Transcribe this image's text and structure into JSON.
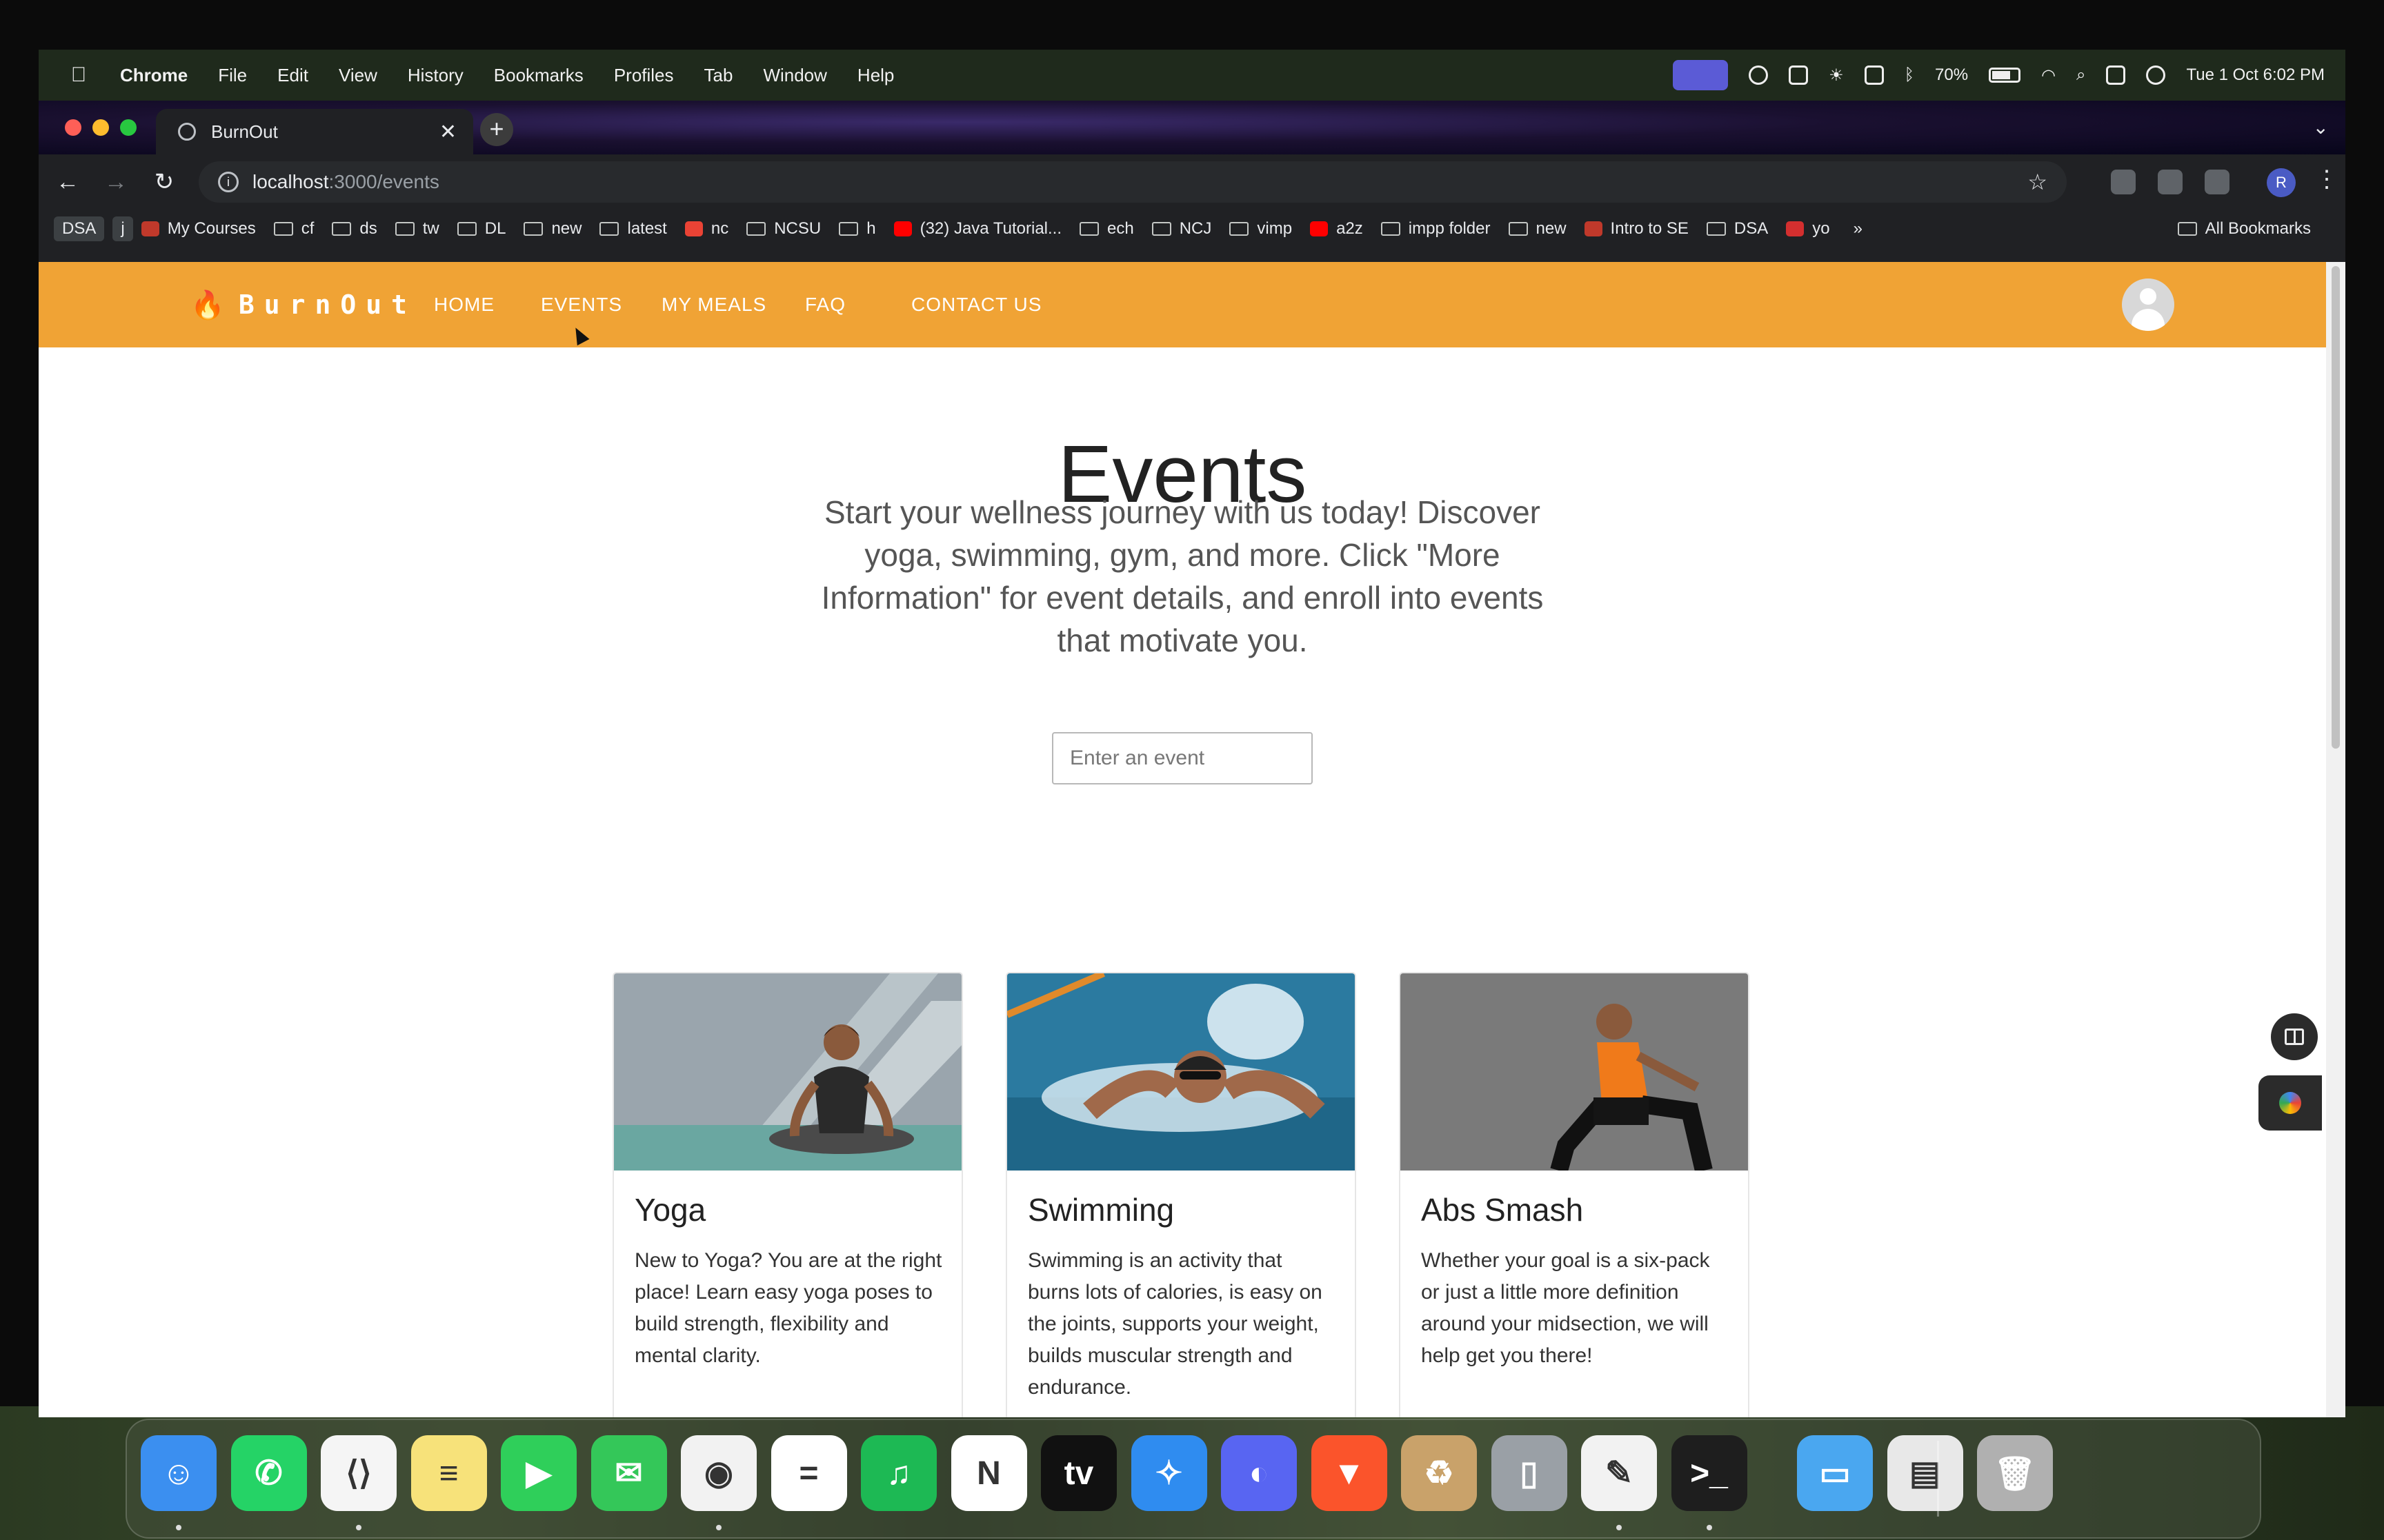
{
  "menubar": {
    "app_name": "Chrome",
    "menus": [
      "File",
      "Edit",
      "View",
      "History",
      "Bookmarks",
      "Profiles",
      "Tab",
      "Window",
      "Help"
    ],
    "battery": "70%",
    "datetime": "Tue 1 Oct  6:02 PM"
  },
  "browser": {
    "tab_title": "BurnOut",
    "url_host": "localhost",
    "url_rest": ":3000/events",
    "profile_initial": "R",
    "bookmarks": [
      {
        "label": "DSA",
        "kind": "badge"
      },
      {
        "label": "j",
        "kind": "badge"
      },
      {
        "label": "My Courses",
        "kind": "site",
        "color": "#c0392b"
      },
      {
        "label": "cf",
        "kind": "folder"
      },
      {
        "label": "ds",
        "kind": "folder"
      },
      {
        "label": "tw",
        "kind": "folder"
      },
      {
        "label": "DL",
        "kind": "folder"
      },
      {
        "label": "new",
        "kind": "folder"
      },
      {
        "label": "latest",
        "kind": "folder"
      },
      {
        "label": "nc",
        "kind": "site",
        "color": "#ea4335"
      },
      {
        "label": "NCSU",
        "kind": "folder"
      },
      {
        "label": "h",
        "kind": "folder"
      },
      {
        "label": "(32) Java Tutorial...",
        "kind": "site",
        "color": "#ff0000"
      },
      {
        "label": "ech",
        "kind": "folder"
      },
      {
        "label": "NCJ",
        "kind": "folder"
      },
      {
        "label": "vimp",
        "kind": "folder"
      },
      {
        "label": "a2z",
        "kind": "site",
        "color": "#ff0000"
      },
      {
        "label": "impp folder",
        "kind": "folder"
      },
      {
        "label": "new",
        "kind": "folder"
      },
      {
        "label": "Intro to SE",
        "kind": "site",
        "color": "#c0392b"
      },
      {
        "label": "DSA",
        "kind": "folder"
      },
      {
        "label": "yo",
        "kind": "site",
        "color": "#d32f2f"
      }
    ],
    "more_bookmarks": "»",
    "all_bookmarks": "All Bookmarks"
  },
  "site": {
    "brand": "BurnOut",
    "accent_color": "#f0a335",
    "nav": [
      "HOME",
      "EVENTS",
      "MY MEALS",
      "FAQ",
      "CONTACT US"
    ],
    "page_title": "Events",
    "intro": "Start your wellness journey with us today! Discover yoga, swimming, gym, and more. Click \"More Information\" for event details, and enroll into events that motivate you.",
    "search_placeholder": "Enter an event",
    "cards": [
      {
        "title": "Yoga",
        "text": "New to Yoga? You are at the right place! Learn easy yoga poses to build strength, flexibility and mental clarity.",
        "image": "yoga-photo"
      },
      {
        "title": "Swimming",
        "text": "Swimming is an activity that burns lots of calories, is easy on the joints, supports your weight, builds muscular strength and endurance.",
        "image": "swimming-photo"
      },
      {
        "title": "Abs Smash",
        "text": "Whether your goal is a six-pack or just a little more definition around your midsection, we will help get you there!",
        "image": "abs-photo"
      }
    ]
  },
  "dock": {
    "apps": [
      {
        "name": "Finder",
        "color": "#3b8ff0",
        "glyph": "☺"
      },
      {
        "name": "WhatsApp",
        "color": "#25d366",
        "glyph": "✆"
      },
      {
        "name": "Visual Studio Code",
        "color": "#f5f5f5",
        "glyph": "⟨⟩"
      },
      {
        "name": "Notes",
        "color": "#f7e27a",
        "glyph": "≡"
      },
      {
        "name": "FaceTime",
        "color": "#2fcf5a",
        "glyph": "▶"
      },
      {
        "name": "Messages",
        "color": "#34c759",
        "glyph": "✉"
      },
      {
        "name": "Google Chrome",
        "color": "#f2f2f2",
        "glyph": "◉"
      },
      {
        "name": "Todoist",
        "color": "#ffffff",
        "glyph": "="
      },
      {
        "name": "Spotify",
        "color": "#1db954",
        "glyph": "♫"
      },
      {
        "name": "Notion",
        "color": "#ffffff",
        "glyph": "N"
      },
      {
        "name": "Apple TV",
        "color": "#111111",
        "glyph": "tv"
      },
      {
        "name": "Safari",
        "color": "#2f8cf0",
        "glyph": "✧"
      },
      {
        "name": "Discord",
        "color": "#5865f2",
        "glyph": "◐"
      },
      {
        "name": "Brave",
        "color": "#fb542b",
        "glyph": "▼"
      },
      {
        "name": "Archive Utility",
        "color": "#c9a26a",
        "glyph": "♻"
      },
      {
        "name": "iPhone Mirroring",
        "color": "#9aa0a6",
        "glyph": "▯"
      },
      {
        "name": "TextEdit",
        "color": "#f2f2f2",
        "glyph": "✎"
      },
      {
        "name": "Terminal",
        "color": "#1e1e1e",
        "glyph": ">_"
      },
      {
        "name": "Folder",
        "color": "#4aa7f0",
        "glyph": "▭"
      },
      {
        "name": "PDF Document",
        "color": "#e8e8e8",
        "glyph": "▤"
      },
      {
        "name": "Trash",
        "color": "#b0b0b0",
        "glyph": "🗑"
      }
    ]
  }
}
